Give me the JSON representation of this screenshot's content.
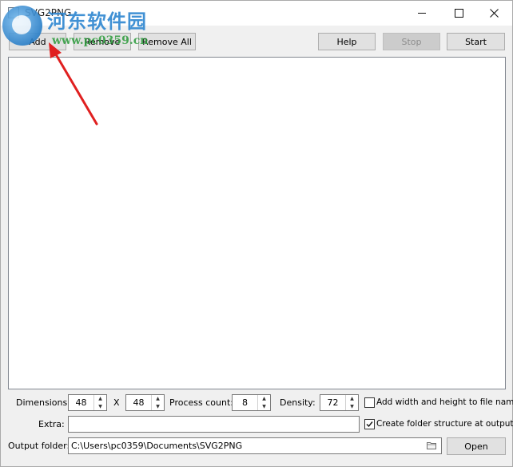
{
  "window": {
    "title": "SVG2PNG"
  },
  "watermark": {
    "brand": "河东软件园",
    "url": "www.pc0359.cn"
  },
  "toolbar": {
    "add_label": "Add",
    "remove_label": "Remove",
    "remove_all_label": "Remove All",
    "help_label": "Help",
    "stop_label": "Stop",
    "start_label": "Start"
  },
  "settings": {
    "dimensions_label": "Dimensions:",
    "width_value": "48",
    "x_label": "X",
    "height_value": "48",
    "process_count_label": "Process count:",
    "process_count_value": "8",
    "density_label": "Density:",
    "density_value": "72",
    "add_wh_label": "Add width and height to file name",
    "add_wh_checked": false,
    "extra_label": "Extra:",
    "extra_value": "",
    "folder_structure_label": "Create folder structure at output",
    "folder_structure_checked": true,
    "output_folder_label": "Output folder:",
    "output_folder_value": "C:\\Users\\pc0359\\Documents\\SVG2PNG",
    "open_label": "Open"
  },
  "colors": {
    "annotation_arrow": "#e02020",
    "watermark_blue": "#2d86d0",
    "watermark_green": "#2a9a3a"
  }
}
